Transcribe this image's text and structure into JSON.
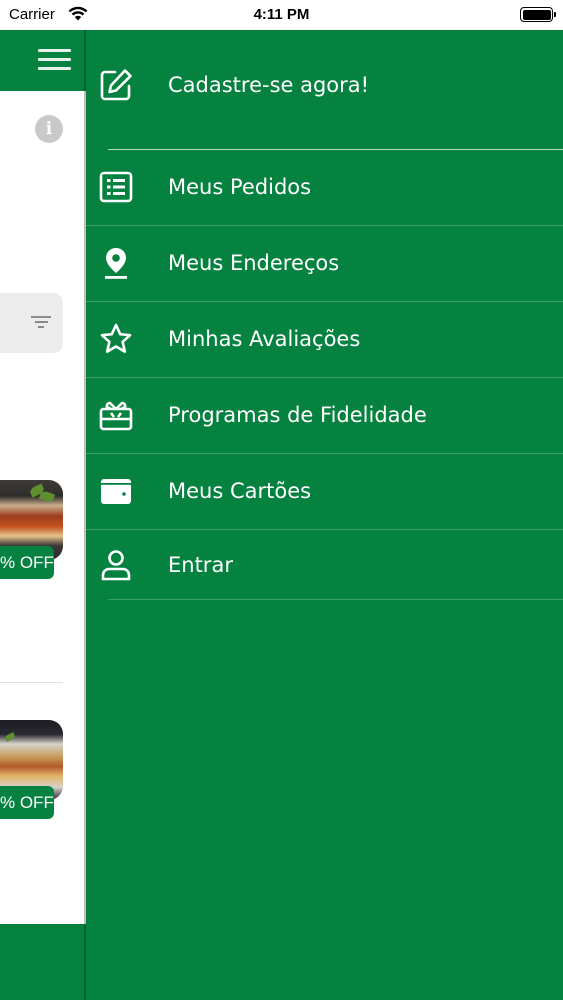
{
  "status_bar": {
    "carrier": "Carrier",
    "time": "4:11 PM"
  },
  "background_screen": {
    "badges": [
      "% OFF",
      "% OFF"
    ]
  },
  "drawer": {
    "items": [
      {
        "label": "Cadastre-se agora!",
        "icon": "edit-icon"
      },
      {
        "label": "Meus Pedidos",
        "icon": "order-list-icon"
      },
      {
        "label": "Meus Endereços",
        "icon": "location-pin-icon"
      },
      {
        "label": "Minhas Avaliações",
        "icon": "star-icon"
      },
      {
        "label": "Programas de Fidelidade",
        "icon": "gift-icon"
      },
      {
        "label": "Meus Cartões",
        "icon": "wallet-icon"
      },
      {
        "label": "Entrar",
        "icon": "user-icon"
      }
    ]
  },
  "colors": {
    "primary": "#068240",
    "text_on_primary": "#ffffff"
  }
}
